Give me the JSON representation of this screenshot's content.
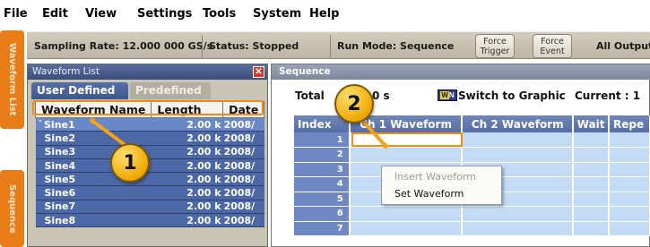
{
  "menu": {
    "items": [
      "File",
      "Edit",
      "View",
      "Settings",
      "Tools",
      "System",
      "Help"
    ]
  },
  "status": {
    "sampling_rate": "Sampling Rate: 12.000 000 GS/s",
    "status": "Status: Stopped",
    "run_mode": "Run Mode: Sequence",
    "force_trigger": [
      "Force",
      "Trigger"
    ],
    "force_event": [
      "Force",
      "Event"
    ],
    "all_outputs": "All Outputs"
  },
  "side_tabs": {
    "waveform_list": "Waveform List",
    "sequence": "Sequence"
  },
  "waveform_list": {
    "title": "Waveform List",
    "close_icon": "close-icon",
    "tabs": [
      "User Defined",
      "Predefined"
    ],
    "columns": [
      "Waveform Name",
      "Length",
      "Date"
    ],
    "rows": [
      {
        "name": "Sine1",
        "length": "2.00 k",
        "date": "2008/"
      },
      {
        "name": "Sine2",
        "length": "2.00 k",
        "date": "2008/"
      },
      {
        "name": "Sine3",
        "length": "2.00 k",
        "date": "2008/"
      },
      {
        "name": "Sine4",
        "length": "2.00 k",
        "date": "2008/"
      },
      {
        "name": "Sine5",
        "length": "2.00 k",
        "date": "2008/"
      },
      {
        "name": "Sine6",
        "length": "2.00 k",
        "date": "2008/"
      },
      {
        "name": "Sine7",
        "length": "2.00 k",
        "date": "2008/"
      },
      {
        "name": "Sine8",
        "length": "2.00 k",
        "date": "2008/"
      }
    ],
    "selected_marker": "˅"
  },
  "sequence": {
    "title": "Sequence",
    "total_label": "Total",
    "total_value": "0 s",
    "switch_icon": "switch-graphic-icon",
    "switch_label": "Switch to Graphic",
    "current": "Current : 1",
    "columns": [
      "Index",
      "Ch 1 Waveform",
      "Ch 2 Waveform",
      "Wait",
      "Repe"
    ],
    "indices": [
      "1",
      "2",
      "3",
      "4",
      "5",
      "6",
      "7"
    ]
  },
  "context_menu": {
    "items": [
      "Insert Waveform",
      "Set Waveform"
    ]
  },
  "callouts": [
    "1",
    "2"
  ],
  "colors": {
    "accent_orange": "#e87d17",
    "panel_blue": "#4d68a6",
    "callout_yellow": "#f0a800",
    "grid_cell": "#c3dbf5"
  }
}
